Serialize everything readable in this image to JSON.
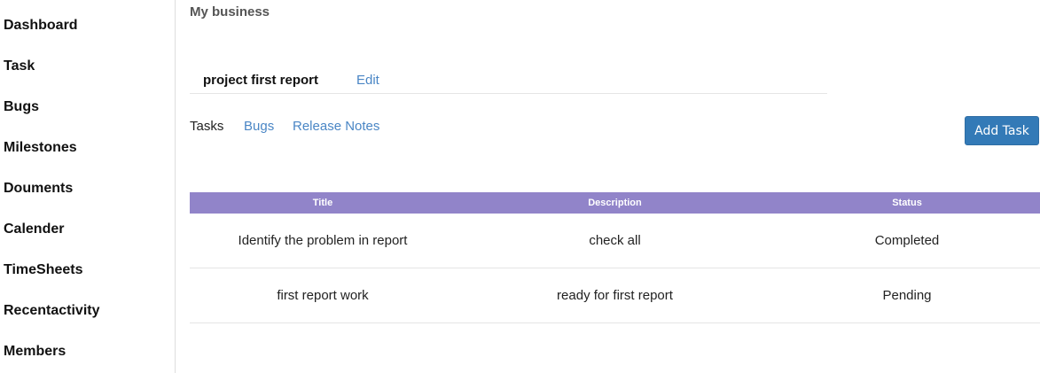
{
  "sidebar": {
    "items": [
      {
        "label": "Dashboard"
      },
      {
        "label": "Task"
      },
      {
        "label": "Bugs"
      },
      {
        "label": "Milestones"
      },
      {
        "label": "Douments"
      },
      {
        "label": "Calender"
      },
      {
        "label": "TimeSheets"
      },
      {
        "label": "Recentactivity"
      },
      {
        "label": "Members"
      }
    ]
  },
  "main": {
    "page_title": "My business",
    "project": {
      "name": "project first report",
      "edit_label": "Edit"
    },
    "tabs": [
      {
        "label": "Tasks"
      },
      {
        "label": "Bugs"
      },
      {
        "label": "Release Notes"
      }
    ],
    "add_task_label": "Add Task",
    "table": {
      "headers": [
        "Title",
        "Description",
        "Status"
      ],
      "rows": [
        {
          "title": "Identify the problem in report",
          "description": "check all",
          "status": "Completed"
        },
        {
          "title": "first report work",
          "description": "ready for first report",
          "status": "Pending"
        }
      ]
    }
  },
  "colors": {
    "table_header": "#9184c9",
    "link": "#4a86c5",
    "primary_button": "#337ab7"
  }
}
